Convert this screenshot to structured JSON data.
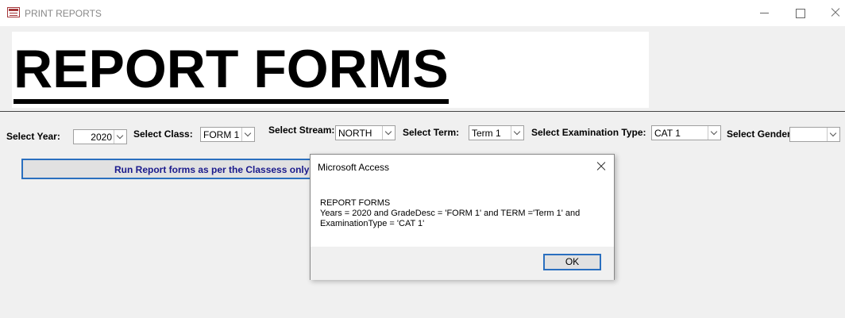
{
  "window": {
    "title": "PRINT REPORTS",
    "icon": "access-form-icon"
  },
  "header": {
    "title": "REPORT FORMS"
  },
  "filters": {
    "year": {
      "label": "Select Year:",
      "value": "2020"
    },
    "class": {
      "label": "Select Class:",
      "value": "FORM 1"
    },
    "stream": {
      "label": "Select Stream:",
      "value": "NORTH"
    },
    "term": {
      "label": "Select Term:",
      "value": "Term 1"
    },
    "exam_type": {
      "label": "Select Examination Type:",
      "value": "CAT 1"
    },
    "gender": {
      "label": "Select Gender:",
      "value": ""
    }
  },
  "run_button": {
    "label": "Run Report forms as per the Classess only  >>>"
  },
  "dialog": {
    "title": "Microsoft Access",
    "lines": [
      "REPORT FORMS",
      "Years = 2020  and GradeDesc = 'FORM 1' and TERM ='Term 1' and",
      "ExaminationType = 'CAT 1'"
    ],
    "ok_label": "OK"
  }
}
